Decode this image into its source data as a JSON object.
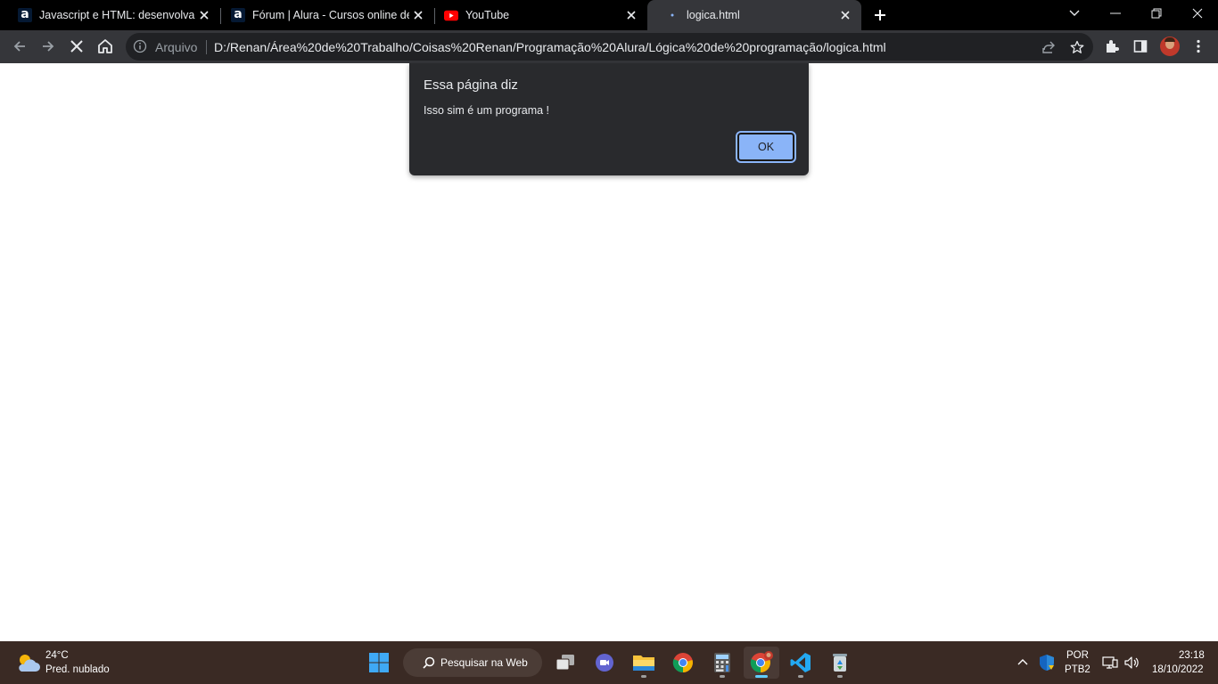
{
  "browser": {
    "tabs": [
      {
        "title": "Javascript e HTML: desenvolva um",
        "icon": "alura-icon"
      },
      {
        "title": "Fórum | Alura - Cursos online de",
        "icon": "alura-icon"
      },
      {
        "title": "YouTube",
        "icon": "youtube-icon"
      },
      {
        "title": "logica.html",
        "icon": "loading-icon",
        "active": true
      }
    ],
    "address_bar": {
      "label": "Arquivo",
      "url": "D:/Renan/Área%20de%20Trabalho/Coisas%20Renan/Programação%20Alura/Lógica%20de%20programação/logica.html"
    }
  },
  "dialog": {
    "title": "Essa página diz",
    "message": "Isso sim é um programa !",
    "ok_label": "OK"
  },
  "taskbar": {
    "weather": {
      "temp": "24°C",
      "condition": "Pred. nublado"
    },
    "search_label": "Pesquisar na Web",
    "language": {
      "line1": "POR",
      "line2": "PTB2"
    },
    "clock": {
      "time": "23:18",
      "date": "18/10/2022"
    }
  },
  "colors": {
    "tabstrip_bg": "#000000",
    "toolbar_bg": "#35363a",
    "dialog_bg": "#292a2d",
    "ok_button": "#8ab4f8",
    "taskbar_bg": "#3a2a24"
  }
}
